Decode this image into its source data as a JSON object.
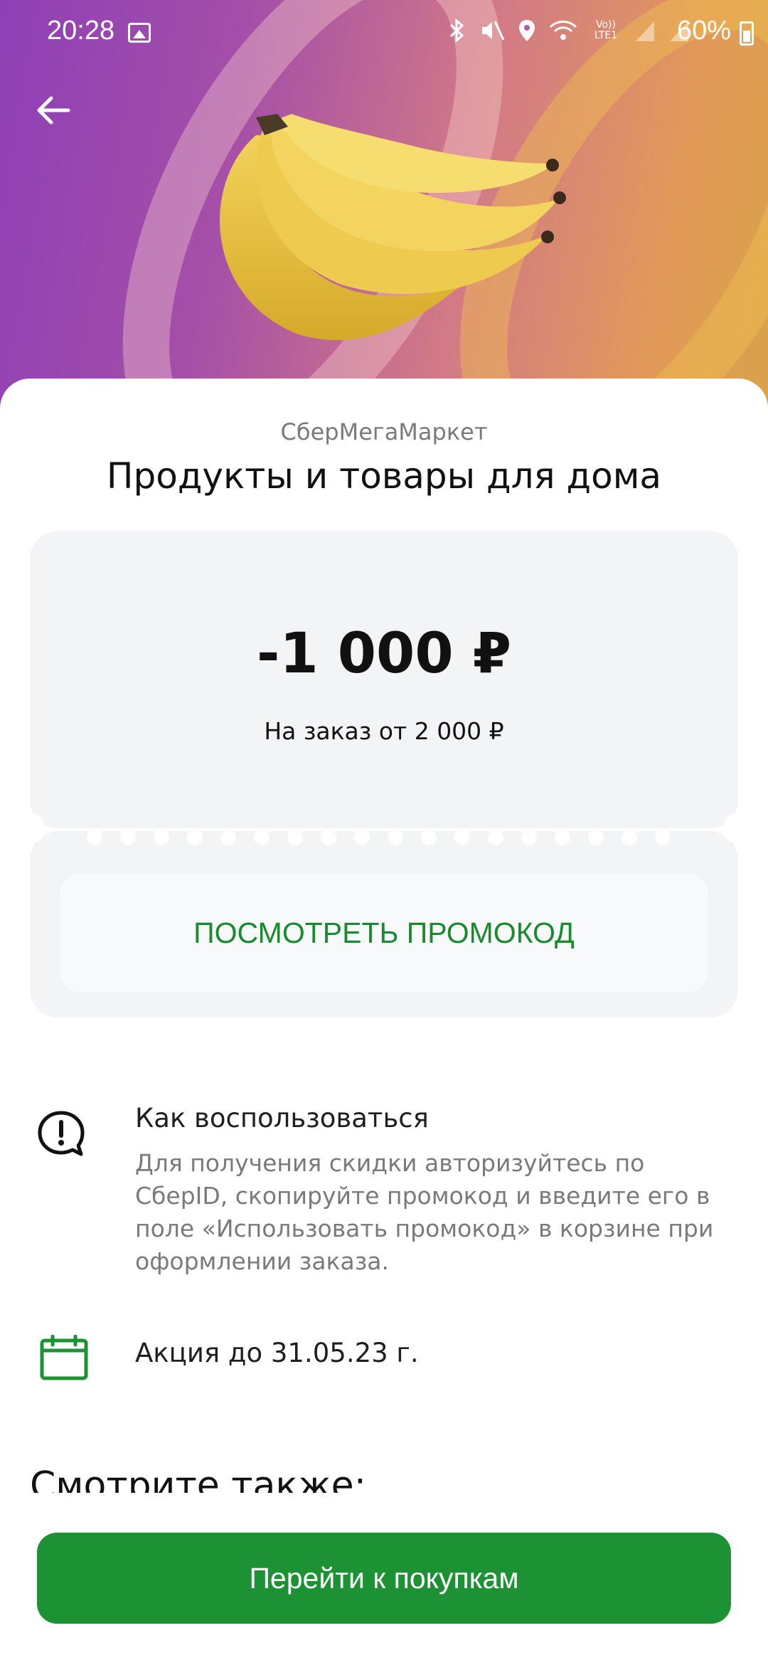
{
  "status_bar": {
    "time": "20:28",
    "battery": "60%",
    "icons": [
      "gallery-icon",
      "bluetooth-icon",
      "mute-icon",
      "location-icon",
      "wifi-icon",
      "volte-icon",
      "signal-icon",
      "signal-icon",
      "battery-icon"
    ],
    "volte_text": "Vo)) LTE1"
  },
  "header": {
    "back_icon": "arrow-left-icon",
    "hero_image": "bananas"
  },
  "offer": {
    "store_name": "СберМегаМаркет",
    "title": "Продукты и товары для дома",
    "discount": "-1 000 ₽",
    "condition": "На заказ от 2 000 ₽",
    "promo_button_label": "ПОСМОТРЕТЬ ПРОМОКОД"
  },
  "info": {
    "how_to_title": "Как воспользоваться",
    "how_to_text": "Для получения скидки авторизуйтесь по СберID, скопируйте промокод и введите его в поле «Использовать промокод» в корзине при оформлении заказа.",
    "how_to_icon": "alert-chat-icon",
    "valid_until": "Акция до 31.05.23 г.",
    "valid_icon": "calendar-icon"
  },
  "see_also": "Смотрите также:",
  "footer": {
    "shop_button_label": "Перейти к покупкам"
  },
  "colors": {
    "accent_green": "#1c9234",
    "promo_text_green": "#1a8a2e",
    "ticket_bg": "#f2f4f6"
  }
}
